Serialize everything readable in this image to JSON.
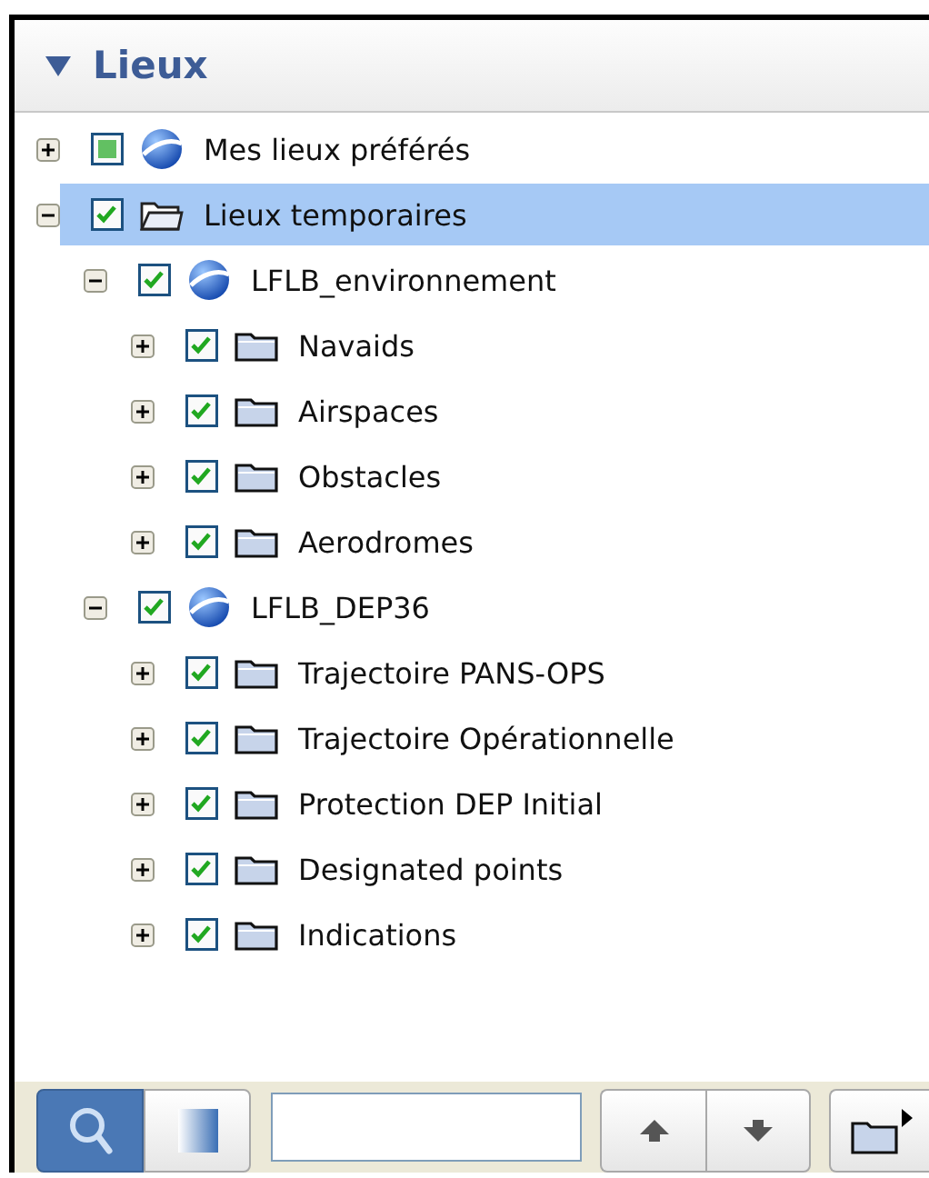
{
  "panel": {
    "title": "Lieux",
    "expanded": true
  },
  "tree": [
    {
      "label": "Mes lieux préférés",
      "kind": "globe",
      "checked": false,
      "partial": true,
      "expanded": false,
      "selected": false
    },
    {
      "label": "Lieux temporaires",
      "kind": "folder-open",
      "checked": true,
      "partial": false,
      "expanded": true,
      "selected": true,
      "children": [
        {
          "label": "LFLB_environnement",
          "kind": "globe",
          "checked": true,
          "partial": false,
          "expanded": true,
          "selected": false,
          "children": [
            {
              "label": "Navaids",
              "kind": "folder",
              "checked": true,
              "partial": false,
              "expanded": false,
              "selected": false
            },
            {
              "label": "Airspaces",
              "kind": "folder",
              "checked": true,
              "partial": false,
              "expanded": false,
              "selected": false
            },
            {
              "label": "Obstacles",
              "kind": "folder",
              "checked": true,
              "partial": false,
              "expanded": false,
              "selected": false
            },
            {
              "label": "Aerodromes",
              "kind": "folder",
              "checked": true,
              "partial": false,
              "expanded": false,
              "selected": false
            }
          ]
        },
        {
          "label": "LFLB_DEP36",
          "kind": "globe",
          "checked": true,
          "partial": false,
          "expanded": true,
          "selected": false,
          "children": [
            {
              "label": "Trajectoire PANS-OPS",
              "kind": "folder",
              "checked": true,
              "partial": false,
              "expanded": false,
              "selected": false
            },
            {
              "label": "Trajectoire Opérationnelle",
              "kind": "folder",
              "checked": true,
              "partial": false,
              "expanded": false,
              "selected": false
            },
            {
              "label": "Protection DEP Initial",
              "kind": "folder",
              "checked": true,
              "partial": false,
              "expanded": false,
              "selected": false
            },
            {
              "label": "Designated points",
              "kind": "folder",
              "checked": true,
              "partial": false,
              "expanded": false,
              "selected": false
            },
            {
              "label": "Indications",
              "kind": "folder",
              "checked": true,
              "partial": false,
              "expanded": false,
              "selected": false
            }
          ]
        }
      ]
    }
  ],
  "toolbar": {
    "modes": [
      {
        "kind": "search",
        "selected": true
      },
      {
        "kind": "panel",
        "selected": false
      }
    ]
  }
}
